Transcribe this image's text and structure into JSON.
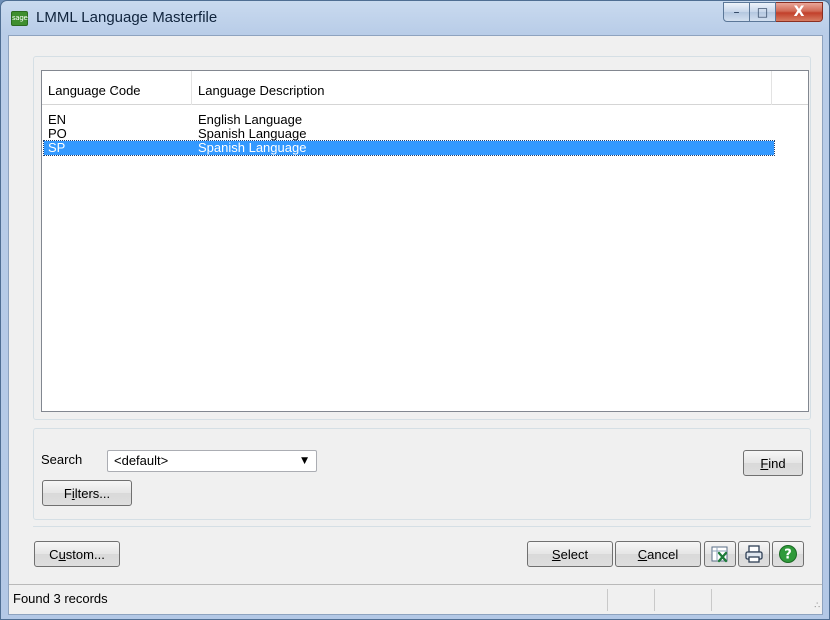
{
  "window": {
    "title": "LMML Language Masterfile",
    "app_icon_text": "sage",
    "minimize_glyph": "–",
    "maximize_glyph": "□",
    "close_glyph": "X"
  },
  "grid": {
    "columns": [
      "Language Code",
      "Language Description"
    ],
    "sort_indicator": "˄",
    "rows": [
      {
        "code": "EN",
        "description": "English Language",
        "selected": false
      },
      {
        "code": "PO",
        "description": "Spanish Language",
        "selected": false
      },
      {
        "code": "SP",
        "description": "Spanish Language",
        "selected": true
      }
    ]
  },
  "search": {
    "label": "Search",
    "value": "<default>",
    "arrow": "▼",
    "find_label_accel": "F",
    "find_label_rest": "ind",
    "filters_label_pre": "F",
    "filters_label_accel": "i",
    "filters_label_rest": "lters..."
  },
  "actions": {
    "custom_accel": "u",
    "custom_pre": "C",
    "custom_rest": "stom...",
    "select_accel": "S",
    "select_rest": "elect",
    "cancel_accel": "C",
    "cancel_rest": "ancel"
  },
  "status": {
    "text": "Found 3 records",
    "grip": "∴"
  },
  "colors": {
    "selection": "#3399ff",
    "excel_green": "#1e7c3a",
    "help_green": "#2f9a3a"
  }
}
